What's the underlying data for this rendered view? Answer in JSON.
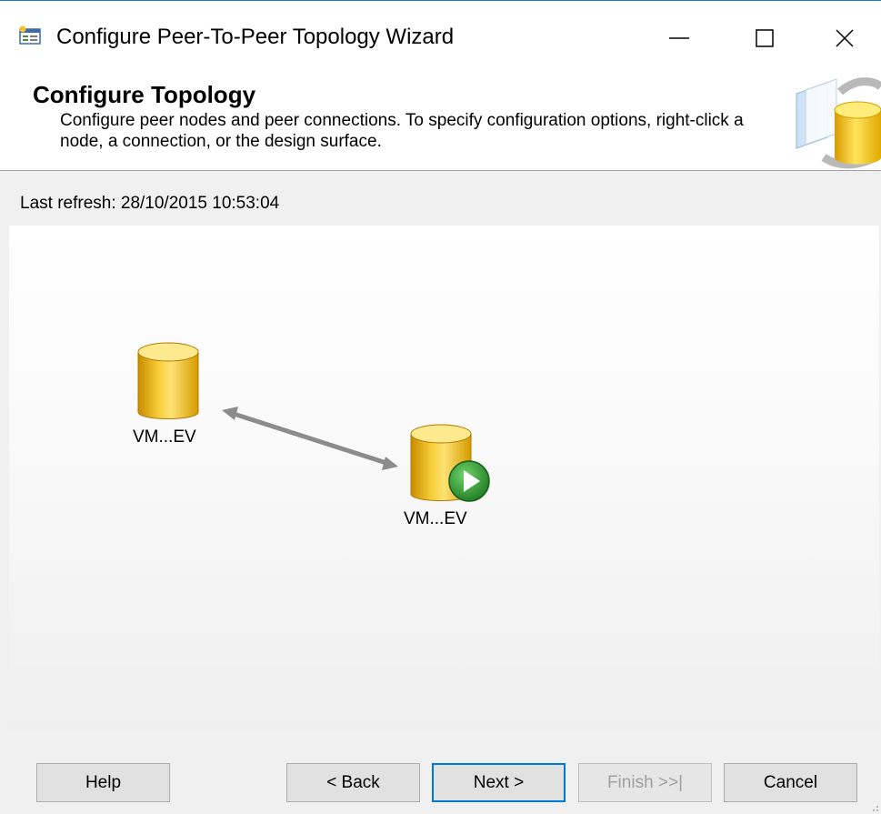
{
  "window": {
    "title": "Configure Peer-To-Peer Topology Wizard",
    "controls": {
      "minimize": "minimize",
      "maximize": "maximize",
      "close": "close"
    }
  },
  "header": {
    "title": "Configure Topology",
    "description": "Configure peer nodes and peer connections. To specify configuration options, right-click a node, a connection, or the design surface."
  },
  "status": {
    "last_refresh": "Last refresh: 28/10/2015 10:53:04"
  },
  "topology": {
    "nodes": [
      {
        "label": "VM...EV",
        "icon": "database-icon"
      },
      {
        "label": "VM...EV",
        "icon": "database-icon",
        "badge": "play-icon"
      }
    ],
    "connection": {
      "type": "bidirectional",
      "icon": "arrow-icon"
    }
  },
  "buttons": {
    "help": "Help",
    "back": "< Back",
    "next": "Next >",
    "finish": "Finish >>|",
    "cancel": "Cancel"
  },
  "colors": {
    "accent": "#0078d7",
    "database": "#e3a400",
    "badge": "#2e8b2e"
  }
}
